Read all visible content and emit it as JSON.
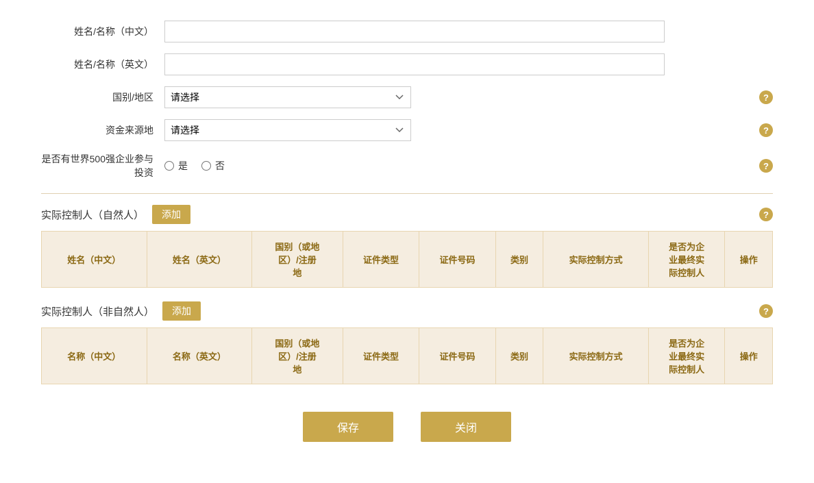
{
  "form": {
    "name_cn_label": "姓名/名称（中文）",
    "name_cn_placeholder": "",
    "name_en_label": "姓名/名称（英文）",
    "name_en_placeholder": "",
    "country_label": "国别/地区",
    "country_placeholder": "请选择",
    "funds_label": "资金来源地",
    "funds_placeholder": "请选择",
    "fortune500_label": "是否有世界500强企业参与投资",
    "yes_label": "是",
    "no_label": "否"
  },
  "natural_controller": {
    "title": "实际控制人（自然人）",
    "add_label": "添加",
    "columns": [
      "姓名（中文）",
      "姓名（英文）",
      "国别（或地区）/注册地",
      "证件类型",
      "证件号码",
      "类别",
      "实际控制方式",
      "是否为企业最终实际控制人",
      "操作"
    ]
  },
  "non_natural_controller": {
    "title": "实际控制人（非自然人）",
    "add_label": "添加",
    "columns": [
      "名称（中文）",
      "名称（英文）",
      "国别（或地区）/注册地",
      "证件类型",
      "证件号码",
      "类别",
      "实际控制方式",
      "是否为企业最终实际控制人",
      "操作"
    ]
  },
  "buttons": {
    "save": "保存",
    "close": "关闭"
  },
  "help_icon": "?"
}
